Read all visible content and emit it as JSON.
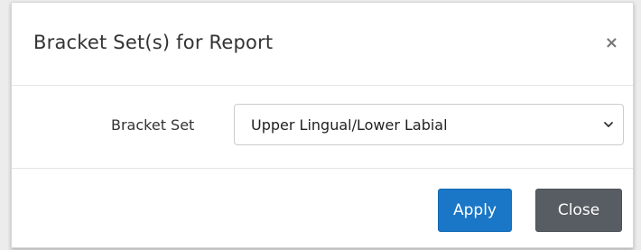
{
  "dialog": {
    "title": "Bracket Set(s) for Report",
    "close_glyph": "×"
  },
  "form": {
    "bracket_set_label": "Bracket Set",
    "bracket_set_value": "Upper Lingual/Lower Labial"
  },
  "footer": {
    "apply_label": "Apply",
    "close_label": "Close"
  },
  "colors": {
    "apply_button": "#1a76c6",
    "close_button": "#575d63"
  },
  "icons": {
    "dismiss": "close-icon",
    "dropdown": "chevron-down-icon"
  }
}
